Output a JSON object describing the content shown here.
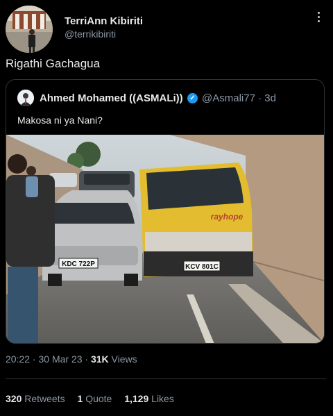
{
  "author": {
    "name": "TerriAnn Kibiriti",
    "handle": "@terrikibiriti"
  },
  "tweet": {
    "text": "Rigathi Gachagua"
  },
  "quoted": {
    "name": "Ahmed Mohamed ((ASMALi))",
    "handle_time": "@Asmali77 · 3d",
    "text": "Makosa ni ya Nani?",
    "photo": {
      "van_brand": "rayhope",
      "car_plate": "KDC 722P",
      "van_plate": "KCV 801C"
    }
  },
  "meta": {
    "time": "20:22 · 30 Mar 23 · ",
    "views_count": "31K",
    "views_label": " Views"
  },
  "stats": {
    "retweets_count": "320",
    "retweets_label": "Retweets",
    "quotes_count": "1",
    "quotes_label": "Quote",
    "likes_count": "1,129",
    "likes_label": "Likes"
  },
  "icons": {
    "more": "more-icon",
    "verified": "verified-badge-icon"
  },
  "colors": {
    "background": "#000000",
    "text": "#e7e9ea",
    "muted": "#8b98a5",
    "verified": "#1d9bf0",
    "border": "#2f3336"
  }
}
